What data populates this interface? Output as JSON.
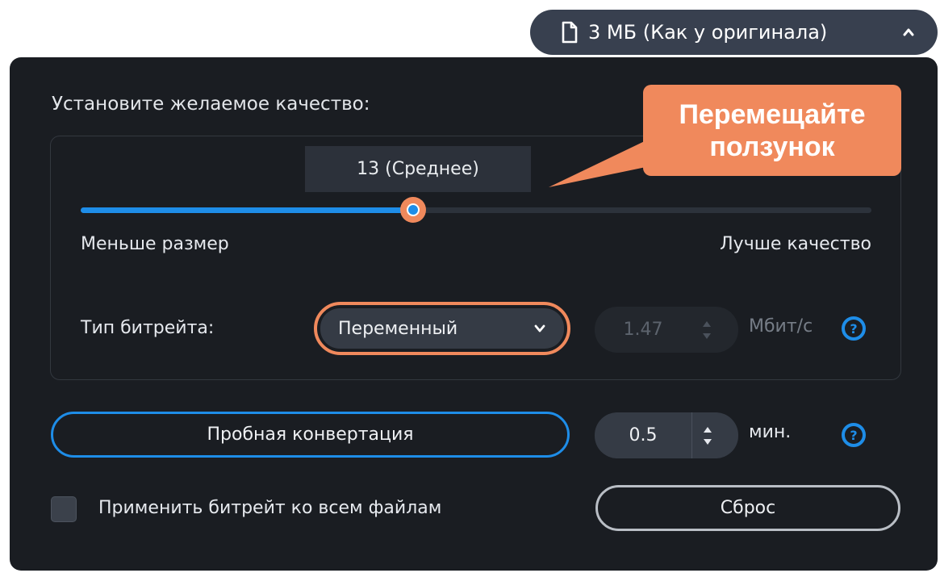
{
  "size_dropdown": {
    "label": "3 МБ (Как у оригинала)"
  },
  "quality": {
    "title": "Установите желаемое качество:",
    "value_label": "13 (Среднее)",
    "slider_fraction": 0.42,
    "min_label": "Меньше размер",
    "max_label": "Лучше качество"
  },
  "callout": {
    "line1": "Перемещайте",
    "line2": "ползунок"
  },
  "bitrate": {
    "label": "Тип битрейта:",
    "selected": "Переменный",
    "value": "1.47",
    "unit": "Мбит/с"
  },
  "trial": {
    "button_label": "Пробная конвертация",
    "duration_value": "0.5",
    "duration_unit": "мин."
  },
  "apply_all": {
    "label": "Применить битрейт ко всем файлам",
    "checked": false
  },
  "reset": {
    "label": "Сброс"
  },
  "help_glyph": "?",
  "colors": {
    "panel_bg": "#1a1d22",
    "accent_blue": "#1e8de8",
    "accent_orange": "#f0895c",
    "pill_bg": "#38404f"
  }
}
